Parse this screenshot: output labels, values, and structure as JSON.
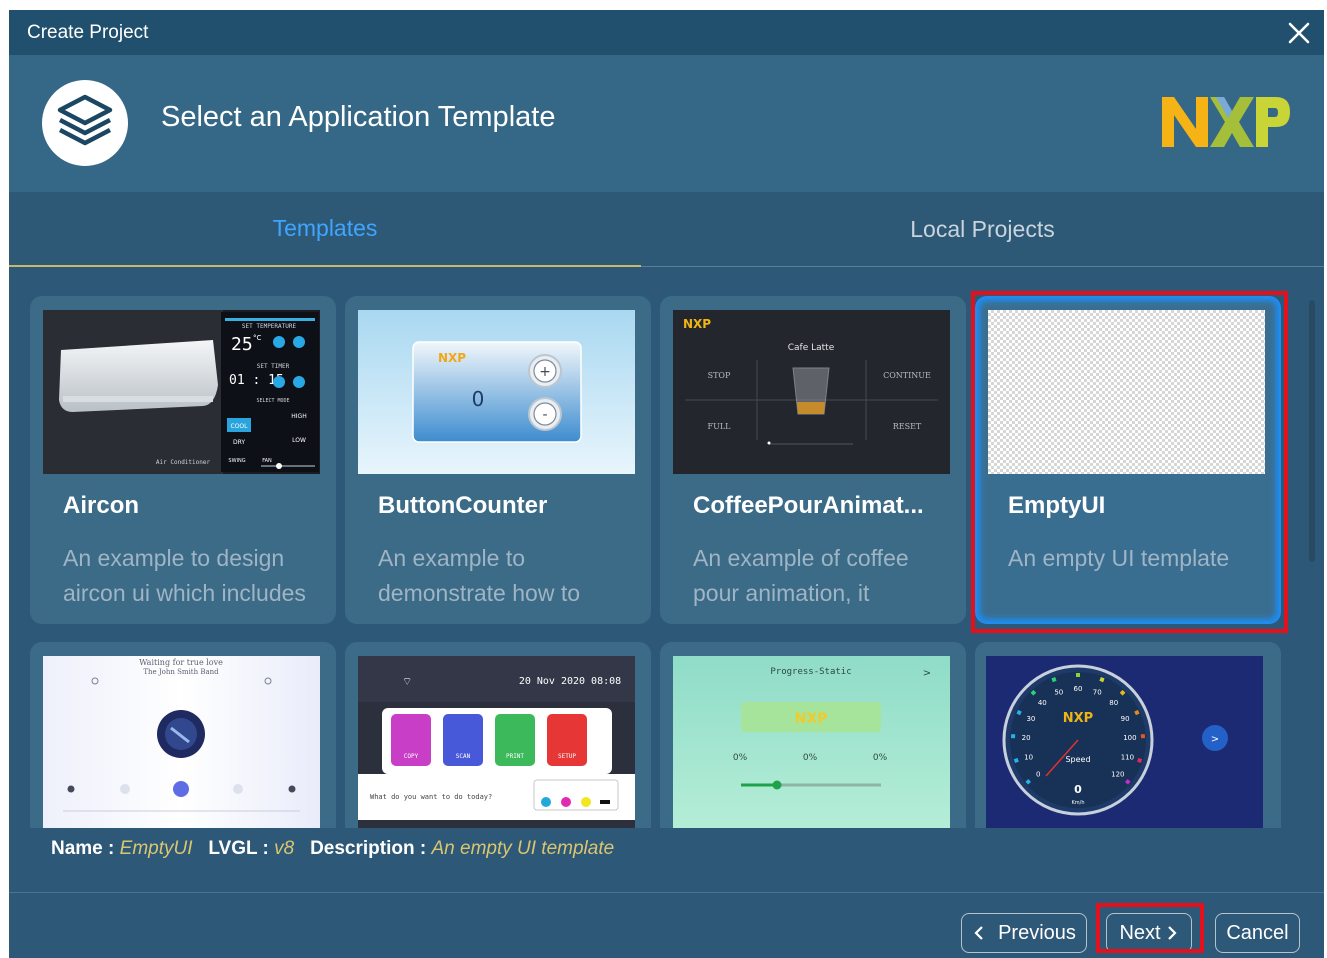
{
  "window": {
    "title": "Create Project",
    "header_title": "Select an Application Template",
    "brand_logo_text": "NXP"
  },
  "tabs": [
    {
      "label": "Templates",
      "active": true
    },
    {
      "label": "Local Projects",
      "active": false
    }
  ],
  "templates": [
    {
      "name": "Aircon",
      "description": "An example to design aircon ui which includes",
      "selected": false
    },
    {
      "name": "ButtonCounter",
      "description": "An example to demonstrate how to",
      "selected": false
    },
    {
      "name": "CoffeePourAnimat...",
      "description": "An example of coffee pour animation, it",
      "selected": false
    },
    {
      "name": "EmptyUI",
      "description": "An empty UI template",
      "selected": true
    }
  ],
  "thumb_text": {
    "aircon": {
      "temp_label": "SET TEMPERATURE",
      "temp": "25",
      "temp_unit": "°C",
      "timer_label": "SET TIMER",
      "timer": "01 : 15",
      "mode_label": "SELECT MODE",
      "mode_cool": "COOL",
      "mode_dry": "DRY",
      "fan_high": "HIGH",
      "fan_low": "LOW",
      "swing": "SWING",
      "fan": "FAN",
      "footer_label": "Air Conditioner"
    },
    "button_counter": {
      "logo": "NXP",
      "count": "0",
      "plus": "+",
      "minus": "-"
    },
    "coffee": {
      "logo": "NXP",
      "title": "Cafe Latte",
      "stop": "STOP",
      "continue": "CONTINUE",
      "full": "FULL",
      "reset": "RESET"
    },
    "music": {
      "title": "Waiting for true love",
      "artist": "The John Smith Band"
    },
    "printer": {
      "datetime": "20 Nov 2020 08:08",
      "copy": "COPY",
      "scan": "SCAN",
      "print": "PRINT",
      "setup": "SETUP",
      "prompt": "What do you want to do today?"
    },
    "progress": {
      "title": "Progress-Static",
      "logo": "NXP",
      "pct1": "0%",
      "pct2": "0%",
      "pct3": "0%",
      "arrow": ">"
    },
    "speedometer": {
      "logo": "NXP",
      "label": "Speed",
      "value": "0",
      "unit": "Km/h",
      "arrow": ">",
      "ticks": [
        "0",
        "10",
        "20",
        "30",
        "40",
        "50",
        "60",
        "70",
        "80",
        "90",
        "100",
        "110",
        "120"
      ]
    }
  },
  "info": {
    "name_label": "Name :",
    "name_value": "EmptyUI",
    "lvgl_label": "LVGL :",
    "lvgl_value": "v8",
    "description_label": "Description :",
    "description_value": "An empty UI template"
  },
  "buttons": {
    "previous": "Previous",
    "next": "Next",
    "cancel": "Cancel"
  },
  "colors": {
    "title_bar": "#20506d",
    "panel": "#2e5878",
    "header": "#356886",
    "active_tab": "#3fa5ff",
    "info_value": "#d9c66f",
    "highlight": "#e3101e"
  }
}
